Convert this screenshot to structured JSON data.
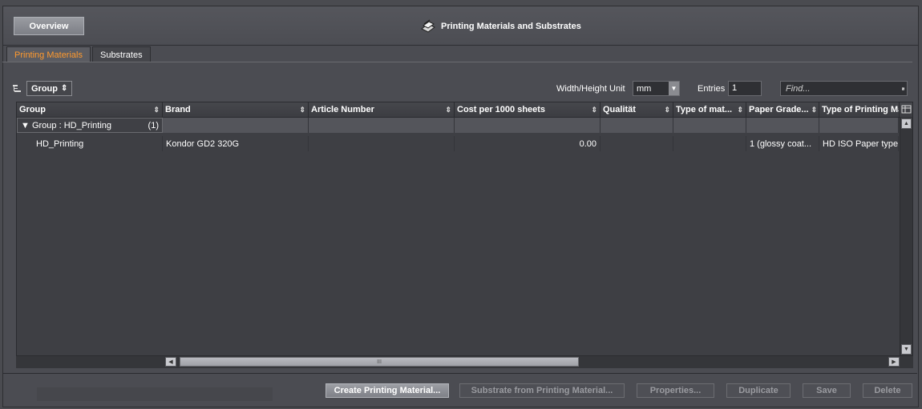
{
  "header": {
    "overview_label": "Overview",
    "title": "Printing Materials and Substrates",
    "icon": "printing-materials-icon"
  },
  "tabs": [
    {
      "label": "Printing Materials",
      "active": true
    },
    {
      "label": "Substrates",
      "active": false
    }
  ],
  "toolbar": {
    "group_by_label": "Group",
    "width_height_unit_label": "Width/Height Unit",
    "unit_value": "mm",
    "entries_label": "Entries",
    "entries_value": "1",
    "find_placeholder": "Find..."
  },
  "table": {
    "columns": [
      "Group",
      "Brand",
      "Article Number",
      "Cost per 1000 sheets",
      "Qualität",
      "Type of mat...",
      "Paper Grade...",
      "Type of Printing Ma"
    ],
    "group_row": {
      "label": "Group : HD_Printing",
      "count": "(1)"
    },
    "rows": [
      [
        "HD_Printing",
        "Kondor GD2 320G",
        "",
        "0.00",
        "",
        "",
        "1 (glossy coat...",
        "HD ISO Paper type"
      ]
    ]
  },
  "buttons": {
    "create": "Create Printing Material...",
    "substrate_from": "Substrate from Printing Material...",
    "properties": "Properties...",
    "duplicate": "Duplicate",
    "save": "Save",
    "delete": "Delete"
  },
  "colors": {
    "accent_tab": "#ff9a2e",
    "background": "#4b4c52"
  }
}
